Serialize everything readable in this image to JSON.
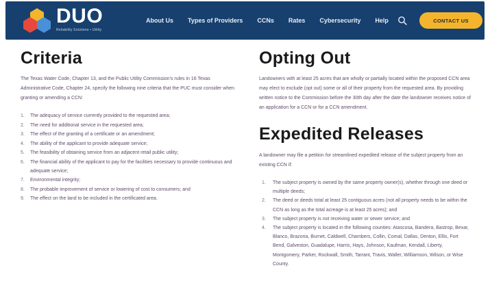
{
  "header": {
    "brand": "DUO",
    "tagline": "Reliability Solutions • Utility",
    "nav": [
      "About Us",
      "Types of Providers",
      "CCNs",
      "Rates",
      "Cybersecurity",
      "Help"
    ],
    "contact_label": "CONTACT US",
    "colors": {
      "header_bg": "#17406f",
      "contact_bg": "#f4b52c"
    }
  },
  "criteria": {
    "title": "Criteria",
    "intro": "The Texas Water Code, Chapter 13, and the Public Utility Commission’s rules in 16 Texas Administrative Code, Chapter 24, specify the following nine criteria that the PUC must consider when granting or amending a CCN:",
    "items": [
      {
        "n": "1.",
        "text": "The adequacy of service currently provided to the requested area;"
      },
      {
        "n": "2.",
        "text": "The need for additional service in the requested area;"
      },
      {
        "n": "3.",
        "text": "The effect of the granting of a certificate or an amendment;"
      },
      {
        "n": "4.",
        "text": "The ability of the applicant to provide adequate service;"
      },
      {
        "n": "5.",
        "text": "The feasibility of obtaining service from an adjacent retail public utility;"
      },
      {
        "n": "6.",
        "text": "The financial ability of the applicant to pay for the facilities necessary to provide continuous and adequate service;"
      },
      {
        "n": "7.",
        "text": "Environmental integrity;"
      },
      {
        "n": "8.",
        "text": "The probable improvement of service or lowering of cost to consumers; and"
      },
      {
        "n": "9.",
        "text": "The effect on the land to be included in the certificated area."
      }
    ]
  },
  "opting_out": {
    "title": "Opting Out",
    "text": "Landowners with at least 25 acres that are wholly or partially located within the proposed CCN area may elect to exclude (opt out) some or all of their property from the requested area. By providing written notice to the Commission before the 30th day after the date the landowner receives notice of an application for a CCN or for a CCN amendment."
  },
  "expedited": {
    "title": "Expedited Releases",
    "intro": "A landowner may file a petition for streamlined expedited release of the subject property from an existing CCN if:",
    "items": [
      {
        "n": "1.",
        "text": "The subject property is owned by the same property owner(s), whether through one deed or multiple deeds;"
      },
      {
        "n": "2.",
        "text": "The deed or deeds total at least 25 contiguous acres (not all property needs to be within the CCN as long as the total acreage is at least 25 acres); and"
      },
      {
        "n": "3.",
        "text": "The subject property is not receiving water or sewer service; and"
      },
      {
        "n": "4.",
        "text": "The subject property is located in the following counties: Atascosa, Bandera, Bastrop, Bexar, Blanco, Brazoria, Burnet, Caldwell, Chambers, Collin, Comal, Dallas, Denton, Ellis, Fort Bend, Galveston, Guadalupe, Harris, Hays, Johnson, Kaufman, Kendall, Liberty, Montgomery, Parker, Rockwall, Smith, Tarrant, Travis, Waller, Williamson, Wilson, or Wise County."
      }
    ]
  }
}
